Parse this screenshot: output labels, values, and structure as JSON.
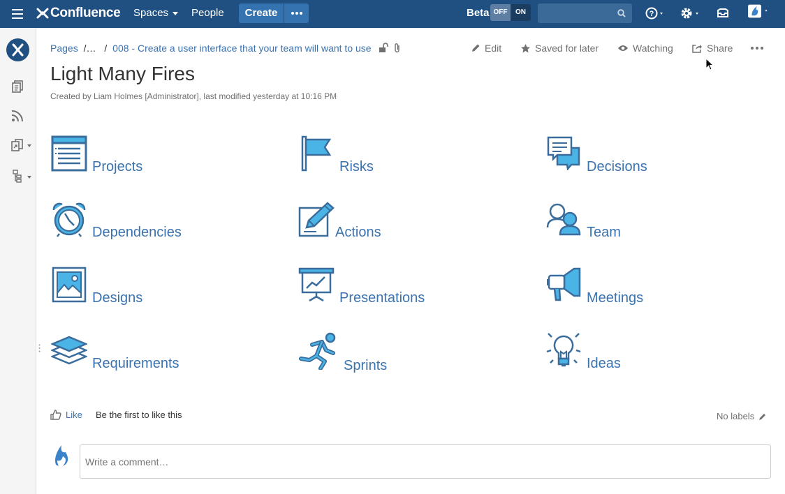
{
  "topbar": {
    "app_name": "Confluence",
    "spaces_label": "Spaces",
    "people_label": "People",
    "create_label": "Create",
    "beta_label": "Beta",
    "toggle_off": "OFF",
    "toggle_on": "ON",
    "search_placeholder": "",
    "icons": [
      "menu-icon",
      "confluence-logo-icon",
      "more-icon",
      "search-icon",
      "help-icon",
      "gear-icon",
      "notifications-icon",
      "user-avatar-icon"
    ]
  },
  "sidebar": {
    "items": [
      "space-logo",
      "pages-icon",
      "blog-feed-icon",
      "shortcuts-icon",
      "page-tree-icon"
    ]
  },
  "breadcrumb": {
    "root": "Pages",
    "ellipsis": "/…",
    "separator": "/",
    "current": "008 - Create a user interface that your team will want to use"
  },
  "page_actions": {
    "edit": "Edit",
    "saved": "Saved for later",
    "watching": "Watching",
    "share": "Share"
  },
  "page": {
    "title": "Light Many Fires",
    "byline": "Created by Liam Holmes [Administrator], last modified yesterday at 10:16 PM"
  },
  "tiles": [
    {
      "label": "Projects",
      "icon": "document-list-icon"
    },
    {
      "label": "Risks",
      "icon": "flag-icon"
    },
    {
      "label": "Decisions",
      "icon": "speech-bubbles-icon"
    },
    {
      "label": "Dependencies",
      "icon": "alarm-clock-icon"
    },
    {
      "label": "Actions",
      "icon": "edit-pencil-icon"
    },
    {
      "label": "Team",
      "icon": "people-icon"
    },
    {
      "label": "Designs",
      "icon": "picture-icon"
    },
    {
      "label": "Presentations",
      "icon": "presentation-board-icon"
    },
    {
      "label": "Meetings",
      "icon": "megaphone-icon"
    },
    {
      "label": "Requirements",
      "icon": "layers-icon"
    },
    {
      "label": "Sprints",
      "icon": "runner-icon"
    },
    {
      "label": "Ideas",
      "icon": "lightbulb-icon"
    }
  ],
  "footer": {
    "like_label": "Like",
    "like_text": "Be the first to like this",
    "labels_text": "No labels",
    "comment_placeholder": "Write a comment…"
  },
  "colors": {
    "header_bg": "#205081",
    "link": "#3b73af",
    "icon_fill": "#4bb4e6",
    "icon_stroke": "#3a6d9c"
  }
}
